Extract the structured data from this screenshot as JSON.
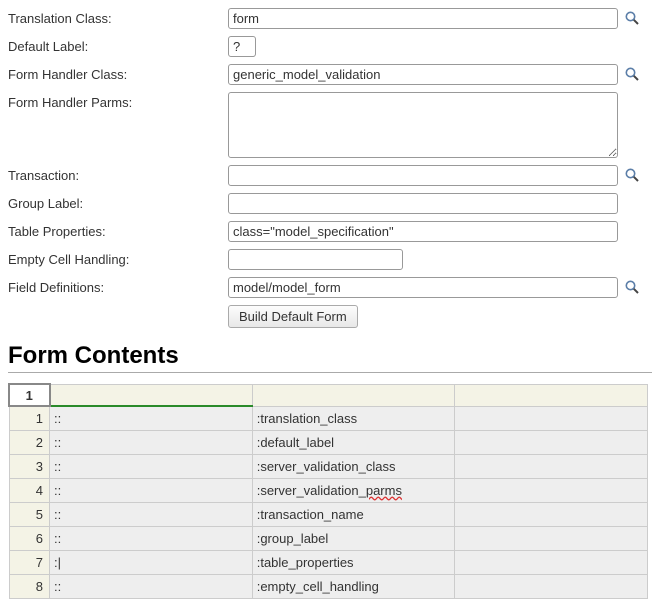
{
  "form": {
    "fields": {
      "translation_class": {
        "label": "Translation Class:",
        "value": "form"
      },
      "default_label": {
        "label": "Default Label:",
        "value": "?"
      },
      "form_handler_class": {
        "label": "Form Handler Class:",
        "value": "generic_model_validation"
      },
      "form_handler_parms": {
        "label": "Form Handler Parms:",
        "value": ""
      },
      "transaction": {
        "label": "Transaction:",
        "value": ""
      },
      "group_label": {
        "label": "Group Label:",
        "value": ""
      },
      "table_properties": {
        "label": "Table Properties:",
        "value": "class=\"model_specification\""
      },
      "empty_cell_handling": {
        "label": "Empty Cell Handling:",
        "value": ""
      },
      "field_definitions": {
        "label": "Field Definitions:",
        "value": "model/model_form"
      }
    },
    "build_button": "Build Default Form"
  },
  "section_title": "Form Contents",
  "grid": {
    "corner": "1",
    "rows": [
      {
        "n": "1",
        "a": "::",
        "b": ":translation_class",
        "c": ""
      },
      {
        "n": "2",
        "a": "::",
        "b": ":default_label",
        "c": ""
      },
      {
        "n": "3",
        "a": "::",
        "b": ":server_validation_class",
        "c": ""
      },
      {
        "n": "4",
        "a": "::",
        "b": ":server_validation_parms",
        "c": ""
      },
      {
        "n": "5",
        "a": "::",
        "b": ":transaction_name",
        "c": ""
      },
      {
        "n": "6",
        "a": "::",
        "b": ":group_label",
        "c": ""
      },
      {
        "n": "7",
        "a": ":|",
        "b": ":table_properties",
        "c": ""
      },
      {
        "n": "8",
        "a": "::",
        "b": ":empty_cell_handling",
        "c": ""
      }
    ]
  }
}
